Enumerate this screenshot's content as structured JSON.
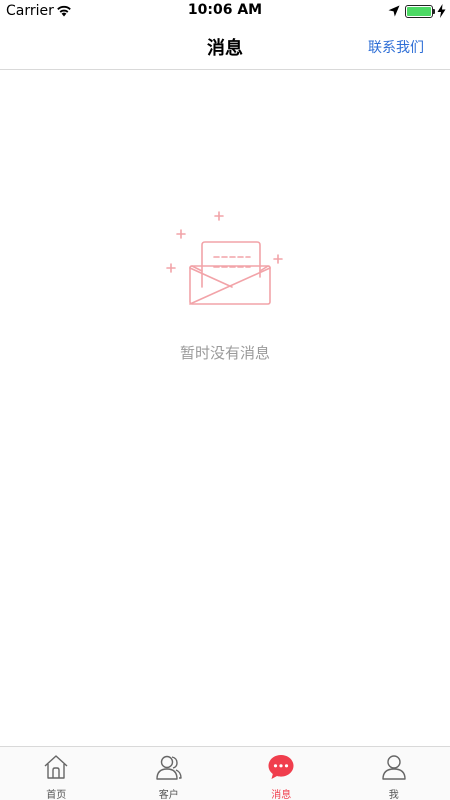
{
  "status_bar": {
    "carrier": "Carrier",
    "time": "10:06 AM",
    "battery_level": 1.0
  },
  "nav": {
    "title": "消息",
    "contact_label": "联系我们"
  },
  "empty_state": {
    "message": "暂时没有消息",
    "icon": "envelope-letter-icon"
  },
  "tabs": [
    {
      "label": "首页",
      "icon": "home-icon",
      "active": false
    },
    {
      "label": "客户",
      "icon": "customers-icon",
      "active": false
    },
    {
      "label": "消息",
      "icon": "message-bubble-icon",
      "active": true
    },
    {
      "label": "我",
      "icon": "profile-icon",
      "active": false
    }
  ],
  "colors": {
    "accent": "#f03e4d",
    "link": "#2f6fd6",
    "illustration": "#f2a3a8",
    "muted_text": "#9a9a9a"
  }
}
